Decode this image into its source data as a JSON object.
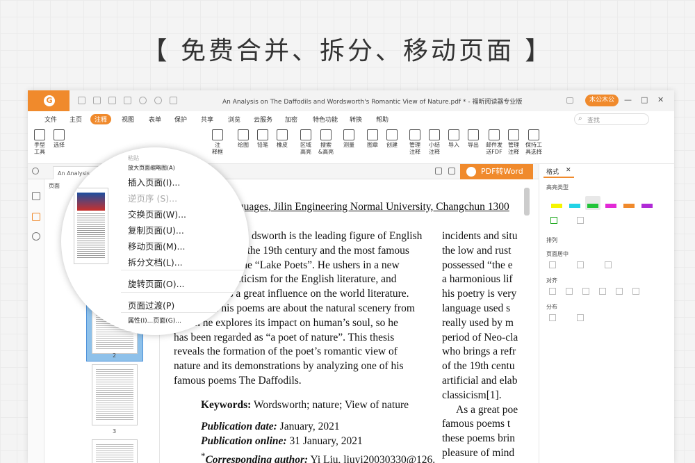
{
  "headline": "【 免费合并、拆分、移动页面 】",
  "titlebar": {
    "doc_title": "An Analysis on The Daffodils and Wordsworth's Romantic View of Nature.pdf * - 福昕阅读器专业版",
    "user": "木公木公",
    "controls": [
      "—",
      "□",
      "✕"
    ]
  },
  "menubar": {
    "items": [
      "文件",
      "主页",
      "注释",
      "视图",
      "表单",
      "保护",
      "共享",
      "浏览",
      "云服务",
      "加密",
      "特色功能",
      "转换",
      "帮助"
    ],
    "active": "注释",
    "search_placeholder": "查找"
  },
  "toolbar": {
    "tools": [
      {
        "label": "手型\n工具",
        "icon": "hand-icon"
      },
      {
        "label": "选择",
        "icon": "select-text-icon"
      },
      {
        "label": "注\n释框",
        "icon": "comment-box-icon"
      },
      {
        "label": "绘图",
        "icon": "drawing-icon"
      },
      {
        "label": "铅笔",
        "icon": "pencil-icon"
      },
      {
        "label": "橡皮",
        "icon": "eraser-icon"
      },
      {
        "label": "区域\n高亮",
        "icon": "area-highlight-icon"
      },
      {
        "label": "搜索\n&高亮",
        "icon": "search-highlight-icon"
      },
      {
        "label": "测量",
        "icon": "measure-icon"
      },
      {
        "label": "图章",
        "icon": "stamp-icon"
      },
      {
        "label": "创建",
        "icon": "create-stamp-icon"
      },
      {
        "label": "管理\n注释",
        "icon": "manage-comments-icon"
      },
      {
        "label": "小结\n注释",
        "icon": "summarize-comments-icon"
      },
      {
        "label": "导入",
        "icon": "import-icon"
      },
      {
        "label": "导出",
        "icon": "export-icon"
      },
      {
        "label": "邮件发\n送FDF",
        "icon": "email-fdf-icon"
      },
      {
        "label": "管理\n注释",
        "icon": "manage-icon"
      },
      {
        "label": "保持工\n具选择",
        "icon": "pin-tool-icon"
      }
    ]
  },
  "tabbar": {
    "tab_label": "An Analysis on The Daffodi...",
    "pdf2word": "PDF转Word"
  },
  "thumbnails": {
    "title": "页面",
    "pages": [
      "1",
      "2",
      "3"
    ]
  },
  "context_menu": {
    "items": [
      {
        "label": "粘贴",
        "disabled": true
      },
      {
        "label": "放大页面缩略图(A)",
        "disabled": false
      },
      {
        "label": "插入页面(I)...",
        "disabled": false
      },
      {
        "label": "逆页序 (S)...",
        "disabled": true
      },
      {
        "label": "交换页面(W)...",
        "disabled": false
      },
      {
        "label": "复制页面(U)...",
        "disabled": false
      },
      {
        "label": "移动页面(M)...",
        "disabled": false
      },
      {
        "label": "拆分文档(L)...",
        "disabled": false
      },
      {
        "label": "旋转页面(O)...",
        "disabled": false
      },
      {
        "label": "页面过渡(P)",
        "disabled": false
      },
      {
        "label": "属性(I)...页面(G)...",
        "disabled": false
      }
    ]
  },
  "document": {
    "affiliation": "rn Languages, Jilin Engineering Normal University, Changchun 1300",
    "col1_para": "William Wordsworth is the leading figure of English romanticism in the 19th century and the most famous one of the “Lake Poets”. He ushers in a new age of romanticism for the English literature, and also exerts a great influence on the world literature. Many of his poems are about the natural scenery from which he explores its impact on human’s soul, so he has been regarded as “a poet of nature”. This thesis reveals the formation of the poet’s romantic view of nature and its demonstrations by analyzing one of his famous poems The Daffodils.",
    "col1_lines": [
      "dsworth is the leading figure of English",
      "n the 19th century and the most famous",
      "the “Lake Poets”. He ushers in a new",
      "manticism for the English literature, and",
      "rts a great influence on the world literature.",
      "y of his poems are about the natural scenery from",
      "which he explores its impact on human’s soul, so he",
      "has been regarded as “a poet of nature”. This thesis",
      "reveals the formation of the poet’s romantic view of",
      "nature and its demonstrations by analyzing one of his",
      "famous poems The Daffodils."
    ],
    "keywords_label": "Keywords:",
    "keywords": "Wordsworth; nature; View of nature",
    "pubdate_label": "Publication date:",
    "pubdate": "January, 2021",
    "pubonline_label": "Publication online:",
    "pubonline": "31 January, 2021",
    "author_label": "Corresponding author:",
    "author": "Yi Liu, liuyi20030330@126.",
    "col2_lines": [
      "incidents and situ",
      "the low and rust",
      "possessed “the e",
      "a harmonious lif",
      "his poetry is very",
      "language used s",
      "really used by m",
      "period of Neo-cla",
      "who brings a refr",
      "of the 19th centu",
      "artificial and elab",
      "classicism[1].",
      "As a great poe",
      "famous poems t",
      "these poems brin",
      "pleasure of mind"
    ]
  },
  "format_panel": {
    "tab": "格式",
    "sections": {
      "highlight_type": "高亮类型",
      "arrange": "排列",
      "page_center": "页面居中",
      "align": "对齐",
      "distribute": "分布"
    },
    "swatch_colors": [
      "#f5f500",
      "#22d3e6",
      "#22c43a",
      "#e22ad6",
      "#f08a2c",
      "#b02ad6"
    ]
  }
}
